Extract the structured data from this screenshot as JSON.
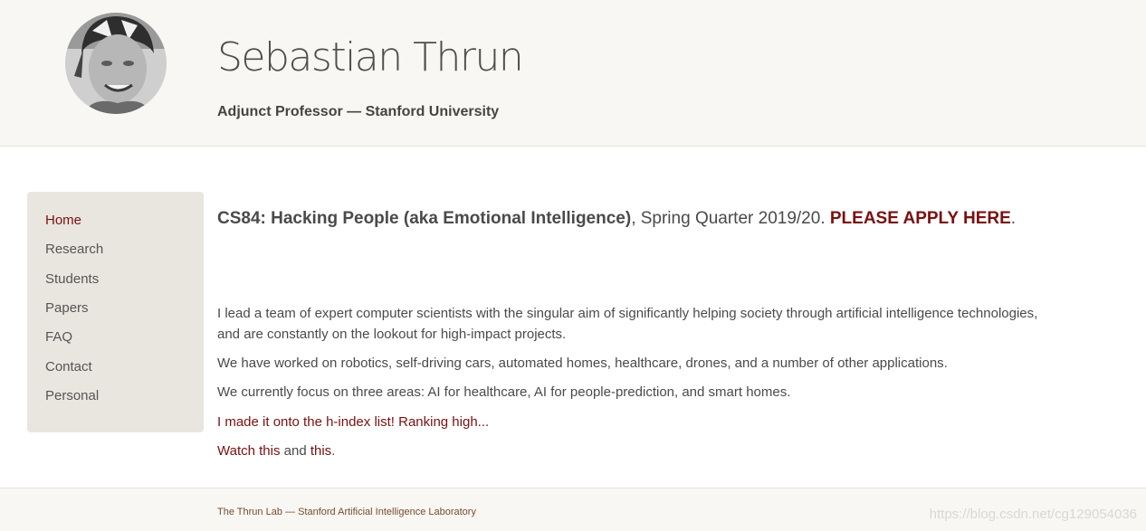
{
  "header": {
    "name": "Sebastian Thrun",
    "subtitle": "Adjunct Professor — Stanford University"
  },
  "sidebar": {
    "items": [
      {
        "label": "Home",
        "active": true
      },
      {
        "label": "Research"
      },
      {
        "label": "Students"
      },
      {
        "label": "Papers"
      },
      {
        "label": "FAQ"
      },
      {
        "label": "Contact"
      },
      {
        "label": "Personal"
      }
    ]
  },
  "main": {
    "headline": {
      "course": "CS84: Hacking People (aka Emotional Intelligence)",
      "quarter": ", Spring Quarter 2019/20. ",
      "apply": "PLEASE APPLY HERE",
      "end": "."
    },
    "paragraphs": [
      "I lead a team of expert computer scientists with the singular aim of significantly helping society through artificial intelligence technologies, and are constantly on the lookout for high-impact projects.",
      "We have worked on robotics, self-driving cars, automated homes, healthcare, drones, and a number of other applications.",
      "We currently focus on three areas: AI for healthcare, AI for people-prediction, and smart homes."
    ],
    "hindex_link": "I made it onto the h-index list! Ranking high...",
    "watch": {
      "link1": "Watch this",
      "middle": " and ",
      "link2": "this",
      "end": "."
    }
  },
  "footer": {
    "text": "The Thrun Lab — Stanford Artificial Intelligence Laboratory",
    "watermark": "https://blog.csdn.net/cg129054036"
  },
  "colors": {
    "accent": "#7a1010",
    "header_bg": "#f8f7f3",
    "sidebar_bg": "#e9e6df"
  },
  "icons": {
    "avatar": "profile-photo"
  }
}
